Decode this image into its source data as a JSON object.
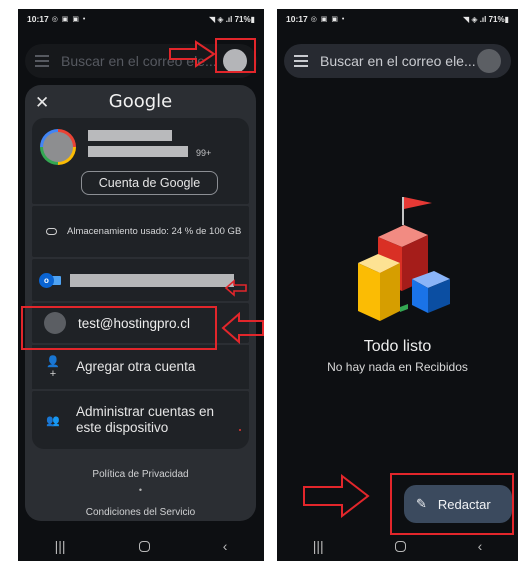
{
  "colors": {
    "annotation_red": "#e2262b",
    "background": "#0d0f12",
    "dialog": "#2b2e33",
    "compose_button": "#3b4a5e"
  },
  "left_screen": {
    "status_time": "10:17",
    "status_right": "◥ ◈ .ıl 71%▮",
    "search_placeholder": "Buscar en el correo ele...",
    "dialog": {
      "close_icon": "close-icon",
      "title": "Google",
      "unread_badge": "99+",
      "google_account_button": "Cuenta de Google",
      "storage_text": "Almacenamiento usado: 24 % de 100 GB",
      "test_account_email": "test@hostingpro.cl",
      "add_account_label": "Agregar otra cuenta",
      "manage_accounts_label": "Administrar cuentas en este dispositivo",
      "privacy_link": "Política de Privacidad",
      "separator": "•",
      "terms_link": "Condiciones del Servicio"
    }
  },
  "right_screen": {
    "status_time": "10:17",
    "status_right": "◥ ◈ .ıl 71%▮",
    "search_placeholder": "Buscar en el correo ele...",
    "empty_title": "Todo listo",
    "empty_subtitle": "No hay nada en Recibidos",
    "compose_label": "Redactar"
  },
  "navbar": {
    "recents_icon": "|||",
    "back_icon": "‹"
  }
}
